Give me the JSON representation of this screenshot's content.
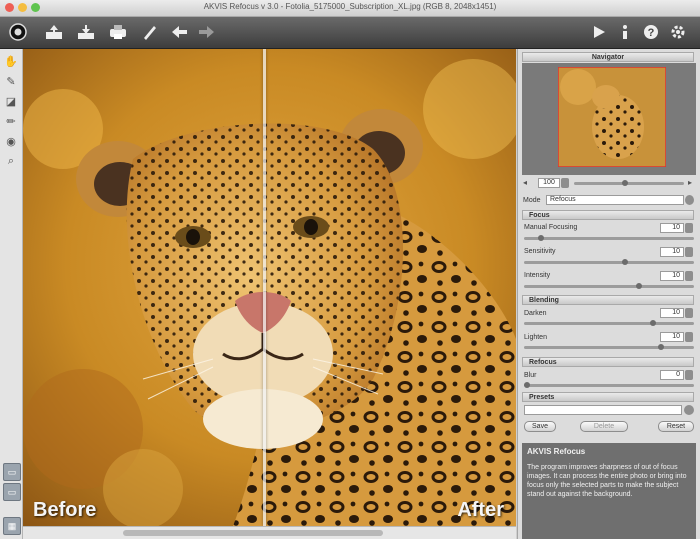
{
  "window": {
    "title": "AKVIS Refocus v 3.0 - Fotolia_5175000_Subscription_XL.jpg (RGB 8, 2048x1451)"
  },
  "toolbar": {
    "icons": [
      "home-icon",
      "open-icon",
      "save-icon",
      "print-icon",
      "brush-icon",
      "undo-icon",
      "redo-icon",
      "run-icon",
      "info-icon",
      "help-icon",
      "settings-icon"
    ]
  },
  "left_tools": {
    "icons": [
      "hand-icon",
      "pen-icon",
      "eraser-icon",
      "pencil-icon",
      "bucket-icon",
      "zoom-icon"
    ]
  },
  "canvas": {
    "before_label": "Before",
    "after_label": "After"
  },
  "panel": {
    "navigator_title": "Navigator",
    "zoom_value": "100",
    "mode_label": "Mode",
    "mode_value": "Refocus",
    "focus_section": "Focus",
    "focus_params": [
      {
        "label": "Manual Focusing",
        "value": "10"
      },
      {
        "label": "Sensitivity",
        "value": "10"
      },
      {
        "label": "Intensity",
        "value": "10"
      }
    ],
    "blending_section": "Blending",
    "blending_params": [
      {
        "label": "Darken",
        "value": "10"
      },
      {
        "label": "Lighten",
        "value": "10"
      }
    ],
    "refocus_section": "Refocus",
    "refocus_params": [
      {
        "label": "Blur",
        "value": "0"
      }
    ],
    "presets_section": "Presets",
    "presets_buttons": [
      "Save",
      "Delete",
      "Reset"
    ],
    "help_title": "AKVIS Refocus",
    "help_text": "The program improves sharpness of out of focus images. It can process the entire photo or bring into focus only the selected parts to make the subject stand out against the background."
  },
  "colors": {
    "toolbar_top": "#6a6a6a",
    "toolbar_bottom": "#3d3d3d",
    "panel_bg": "#dcdcdc",
    "help_bg": "#6f6f6f",
    "close_light": "#ee5f55",
    "min_light": "#f4bd3f",
    "max_light": "#5fc44f"
  }
}
